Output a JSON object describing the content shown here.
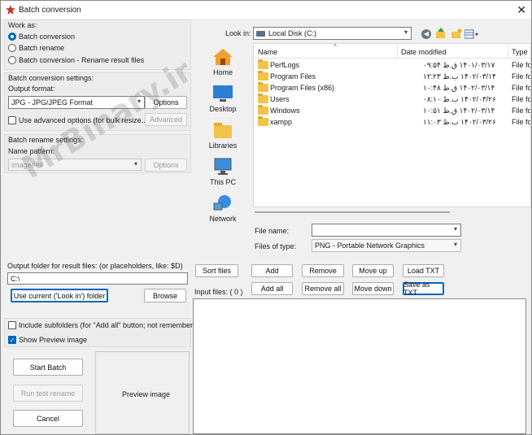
{
  "window": {
    "title": "Batch conversion"
  },
  "work_as": {
    "label": "Work as:",
    "options": [
      {
        "label": "Batch conversion",
        "selected": true
      },
      {
        "label": "Batch rename",
        "selected": false
      },
      {
        "label": "Batch conversion - Rename result files",
        "selected": false
      }
    ]
  },
  "conversion_settings": {
    "label": "Batch conversion settings:",
    "output_format_label": "Output format:",
    "output_format_value": "JPG - JPG/JPEG Format",
    "options_button": "Options",
    "advanced_checkbox": "Use advanced options (for bulk resize...)",
    "advanced_checked": false,
    "advanced_button": "Advanced"
  },
  "rename_settings": {
    "label": "Batch rename settings:",
    "name_pattern_label": "Name pattern:",
    "name_pattern_value": "image###",
    "options_button": "Options"
  },
  "output_folder": {
    "label": "Output folder for result files: (or placeholders, like: $D)",
    "value": "C:\\",
    "use_current_button": "Use current ('Look in') folder",
    "browse_button": "Browse"
  },
  "include_subfolders": {
    "label": "Include subfolders (for \"Add all\" button; not remembered)",
    "checked": false
  },
  "show_preview": {
    "label": "Show Preview image",
    "checked": true
  },
  "actions": {
    "start": "Start Batch",
    "test": "Run test rename",
    "cancel": "Cancel"
  },
  "preview": {
    "label": "Preview image"
  },
  "look_in": {
    "label": "Look in:",
    "value": "Local Disk (C:)"
  },
  "places": [
    "Home",
    "Desktop",
    "Libraries",
    "This PC",
    "Network"
  ],
  "file_list": {
    "headers": {
      "name": "Name",
      "date": "Date modified",
      "type": "Type"
    },
    "rows": [
      {
        "name": "PerfLogs",
        "date": "۱۴۰۱/۰۳/۱۷ ق.ظ ۰۹:۵۴",
        "type": "File fo"
      },
      {
        "name": "Program Files",
        "date": "۱۴۰۲/۰۳/۱۴ ب.ظ ۱۲:۲۳",
        "type": "File fo"
      },
      {
        "name": "Program Files (x86)",
        "date": "۱۴۰۲/۰۳/۱۴ ق.ظ ۱۰:۴۸",
        "type": "File fo"
      },
      {
        "name": "Users",
        "date": "۱۴۰۲/۰۳/۲۶ ب.ظ ۰۸:۱۰",
        "type": "File fo"
      },
      {
        "name": "Windows",
        "date": "۱۴۰۲/۰۳/۱۴ ق.ظ ۱۰:۵۱",
        "type": "File fo"
      },
      {
        "name": "xampp",
        "date": "۱۴۰۲/۰۳/۲۶ ب.ظ ۱۱:۰۳",
        "type": "File fo"
      }
    ]
  },
  "file_name": {
    "label": "File name:",
    "value": ""
  },
  "files_of_type": {
    "label": "Files of type:",
    "value": "PNG - Portable Network Graphics"
  },
  "list_buttons": {
    "sort": "Sort files",
    "add": "Add",
    "remove": "Remove",
    "move_up": "Move up",
    "load_txt": "Load TXT",
    "add_all": "Add all",
    "remove_all": "Remove all",
    "move_down": "Move down",
    "save_txt": "Save as TXT"
  },
  "input_files": {
    "label": "Input files: ( 0 )"
  },
  "watermark": "MrBinary.ir",
  "colors": {
    "accent": "#0067c0",
    "folder": "#f3c24a"
  }
}
